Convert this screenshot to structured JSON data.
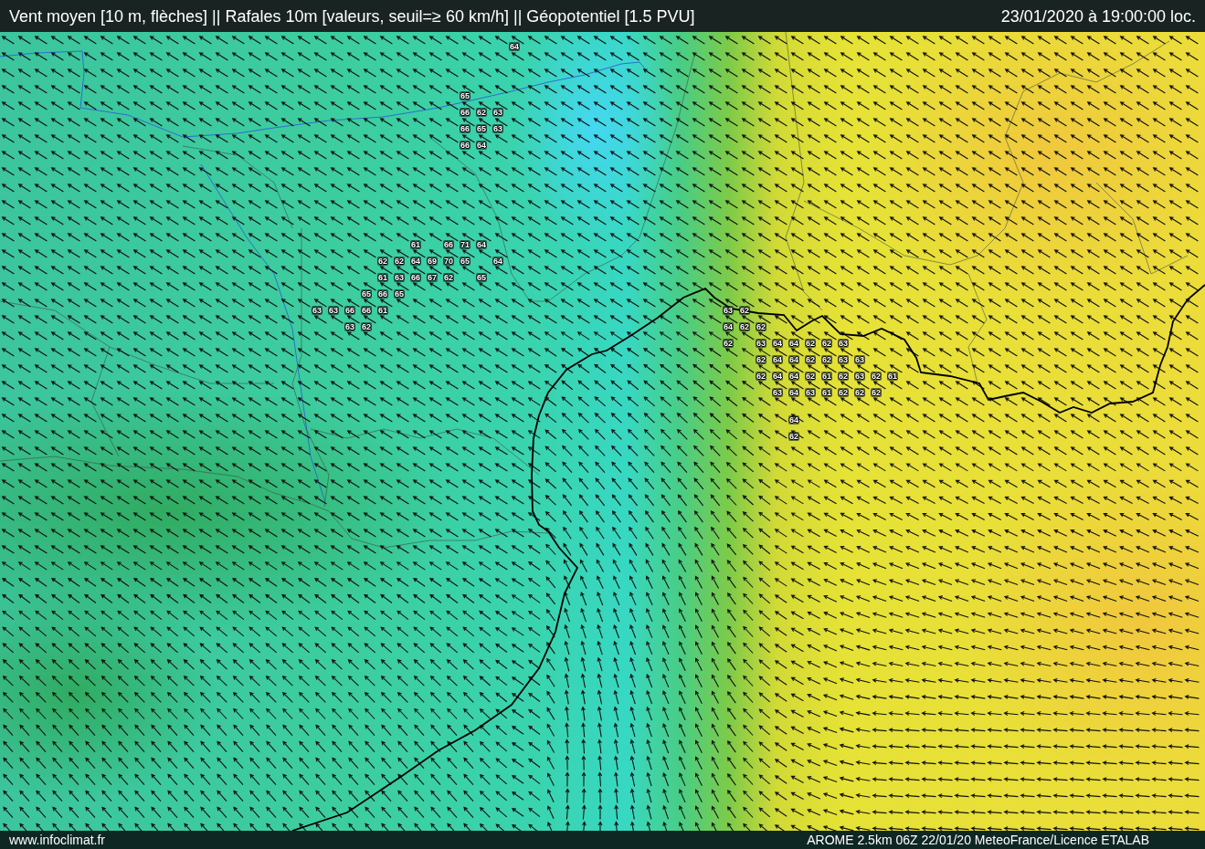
{
  "header": {
    "title": "Vent moyen [10 m, flèches] || Rafales 10m [valeurs, seuil=≥ 60 km/h] || Géopotentiel [1.5 PVU]",
    "datetime": "23/01/2020 à 19:00:00 loc."
  },
  "map": {
    "gust_values": [
      "64",
      "65",
      "66",
      "62",
      "63",
      "66",
      "65",
      "63",
      "66",
      "64",
      "61",
      "66",
      "71",
      "64",
      "62",
      "62",
      "64",
      "69",
      "70",
      "65",
      "64",
      "61",
      "63",
      "66",
      "67",
      "62",
      "65",
      "65",
      "66",
      "65",
      "63",
      "63",
      "66",
      "66",
      "61",
      "63",
      "62",
      "63",
      "62",
      "64",
      "62",
      "62",
      "62",
      "63",
      "64",
      "64",
      "62",
      "62",
      "63",
      "62",
      "64",
      "64",
      "62",
      "62",
      "63",
      "63",
      "62",
      "64",
      "64",
      "62",
      "61",
      "62",
      "63",
      "62",
      "61",
      "63",
      "64",
      "63",
      "61",
      "62",
      "62",
      "62",
      "64",
      "62"
    ]
  },
  "footer": {
    "site": "www.infoclimat.fr",
    "credit": "AROME 2.5km 06Z 22/01/20 MeteoFrance/Licence ETALAB"
  }
}
